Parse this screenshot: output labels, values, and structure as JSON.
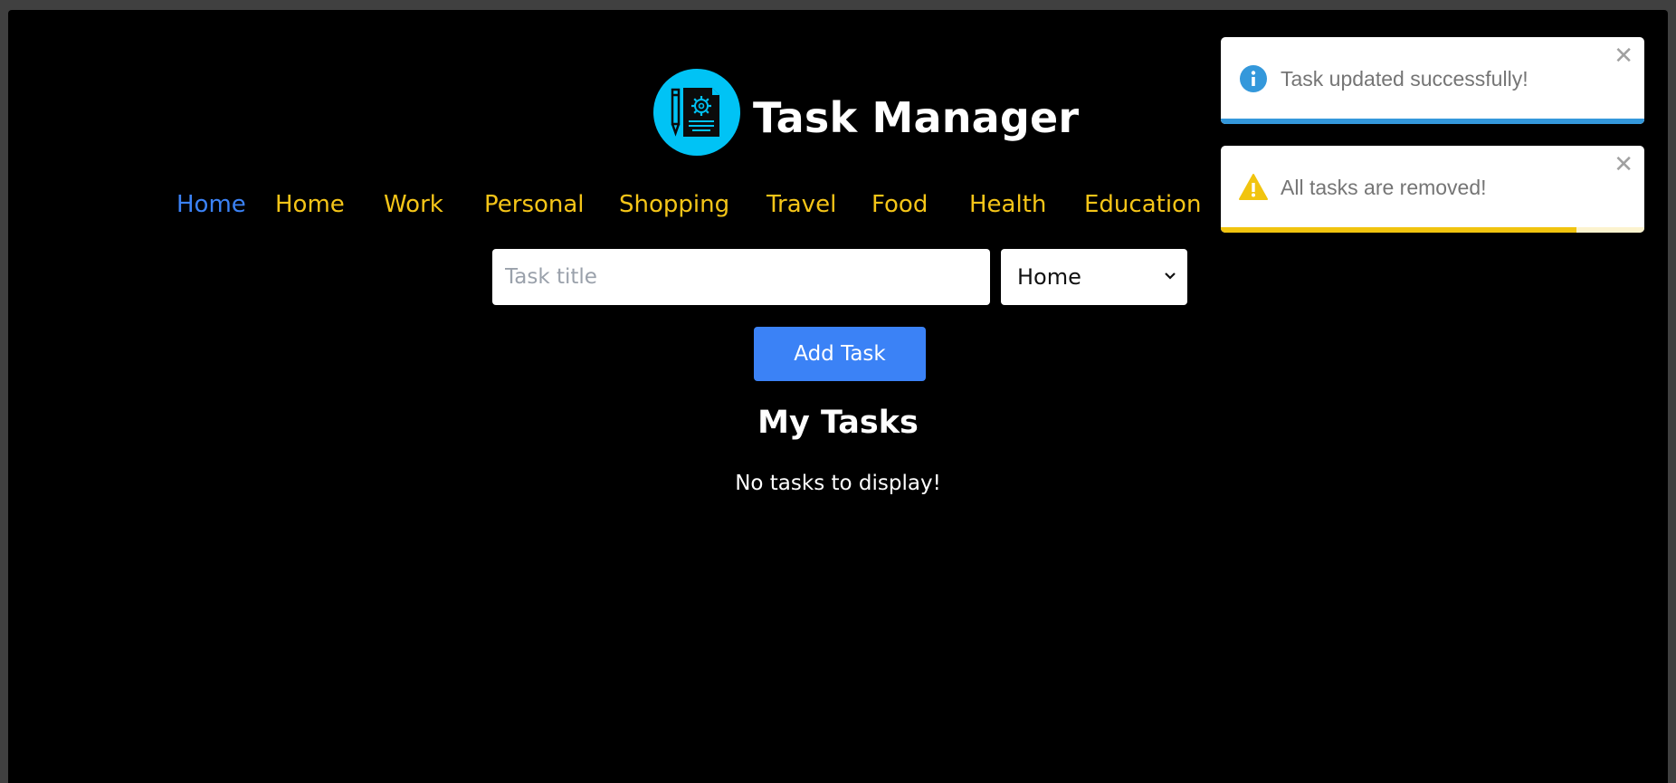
{
  "app": {
    "title": "Task Manager",
    "logo_icon": "task-document-gear-icon",
    "logo_color": "#00c3f5"
  },
  "nav": {
    "items": [
      {
        "label": "Home",
        "active": true
      },
      {
        "label": "Home",
        "active": false
      },
      {
        "label": "Work",
        "active": false
      },
      {
        "label": "Personal",
        "active": false
      },
      {
        "label": "Shopping",
        "active": false
      },
      {
        "label": "Travel",
        "active": false
      },
      {
        "label": "Food",
        "active": false
      },
      {
        "label": "Health",
        "active": false
      },
      {
        "label": "Education",
        "active": false
      }
    ],
    "active_color": "#3b82f6",
    "inactive_color": "#f5c518"
  },
  "form": {
    "title_input": {
      "value": "",
      "placeholder": "Task title"
    },
    "category_select": {
      "selected": "Home"
    },
    "add_button_label": "Add Task",
    "button_color": "#3b82f6"
  },
  "tasks": {
    "heading": "My Tasks",
    "empty_message": "No tasks to display!"
  },
  "toasts": [
    {
      "type": "info",
      "icon": "info-icon",
      "message": "Task updated successfully!",
      "progress": 1.0,
      "color": "#3498db"
    },
    {
      "type": "warning",
      "icon": "warning-icon",
      "message": "All tasks are removed!",
      "progress": 0.84,
      "color": "#f1c40f"
    }
  ]
}
